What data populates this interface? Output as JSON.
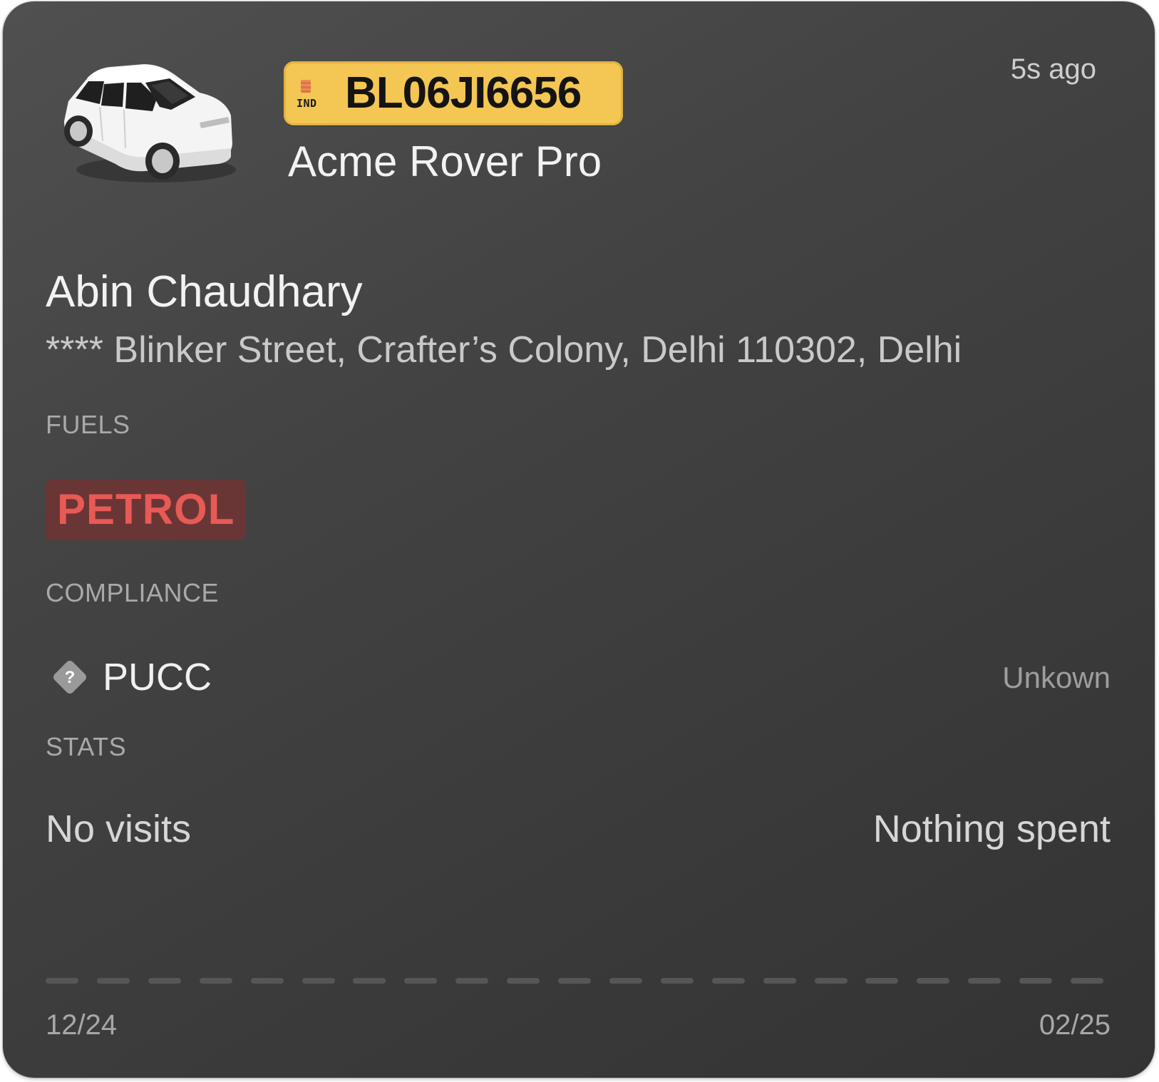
{
  "vehicle": {
    "plate_country": "IND",
    "plate_number": "BL06JI6656",
    "model": "Acme Rover Pro",
    "last_seen": "5s ago",
    "image_icon": "car-icon"
  },
  "owner": {
    "name": "Abin Chaudhary",
    "address": "**** Blinker Street, Crafter’s Colony, Delhi 110302, Delhi"
  },
  "fuels": {
    "label": "FUELS",
    "items": [
      "PETROL"
    ],
    "badge_bg": "#6a3535",
    "badge_fg": "#e85a56"
  },
  "compliance": {
    "label": "COMPLIANCE",
    "items": [
      {
        "name": "PUCC",
        "status": "Unkown",
        "icon": "question-diamond-icon"
      }
    ]
  },
  "stats": {
    "label": "STATS",
    "visits": "No visits",
    "spent": "Nothing spent"
  },
  "timeline": {
    "start": "12/24",
    "end": "02/25",
    "segments": 21
  },
  "colors": {
    "card_bg": "#444444",
    "plate_bg": "#f4c653",
    "text_primary": "#f2f2f2",
    "text_muted": "#a9a9a9"
  }
}
